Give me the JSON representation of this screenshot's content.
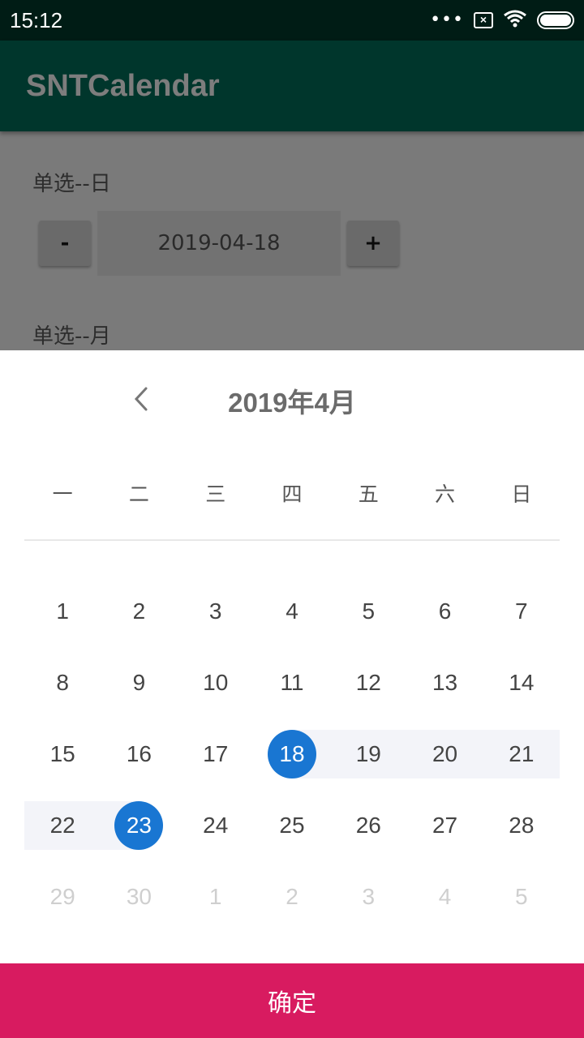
{
  "status_bar": {
    "time": "15:12",
    "dots": "•••",
    "sim_icon": "sim-disabled-icon",
    "wifi_icon": "wifi-icon",
    "battery_icon": "battery-icon"
  },
  "app_bar": {
    "title": "SNTCalendar"
  },
  "background": {
    "section1_label": "单选--日",
    "decrement_label": "-",
    "date_value": "2019-04-18",
    "increment_label": "+",
    "section2_label": "单选--月"
  },
  "calendar": {
    "month_title": "2019年4月",
    "prev_icon": "chevron-left-icon",
    "weekdays": [
      "一",
      "二",
      "三",
      "四",
      "五",
      "六",
      "日"
    ],
    "weeks": [
      [
        {
          "day": "1"
        },
        {
          "day": "2"
        },
        {
          "day": "3"
        },
        {
          "day": "4"
        },
        {
          "day": "5"
        },
        {
          "day": "6"
        },
        {
          "day": "7"
        }
      ],
      [
        {
          "day": "8"
        },
        {
          "day": "9"
        },
        {
          "day": "10"
        },
        {
          "day": "11"
        },
        {
          "day": "12"
        },
        {
          "day": "13"
        },
        {
          "day": "14"
        }
      ],
      [
        {
          "day": "15"
        },
        {
          "day": "16"
        },
        {
          "day": "17"
        },
        {
          "day": "18",
          "state": "selected"
        },
        {
          "day": "19",
          "state": "in-range"
        },
        {
          "day": "20",
          "state": "in-range"
        },
        {
          "day": "21",
          "state": "in-range"
        }
      ],
      [
        {
          "day": "22",
          "state": "in-range"
        },
        {
          "day": "23",
          "state": "selected"
        },
        {
          "day": "24"
        },
        {
          "day": "25"
        },
        {
          "day": "26"
        },
        {
          "day": "27"
        },
        {
          "day": "28"
        }
      ],
      [
        {
          "day": "29",
          "state": "other"
        },
        {
          "day": "30",
          "state": "other"
        },
        {
          "day": "1",
          "state": "other"
        },
        {
          "day": "2",
          "state": "other"
        },
        {
          "day": "3",
          "state": "other"
        },
        {
          "day": "4",
          "state": "other"
        },
        {
          "day": "5",
          "state": "other"
        }
      ]
    ],
    "confirm_label": "确定"
  },
  "colors": {
    "status_bar": "#001c15",
    "app_bar": "#00362c",
    "selected": "#1976d2",
    "range": "#f3f4f9",
    "confirm": "#d81b60"
  }
}
